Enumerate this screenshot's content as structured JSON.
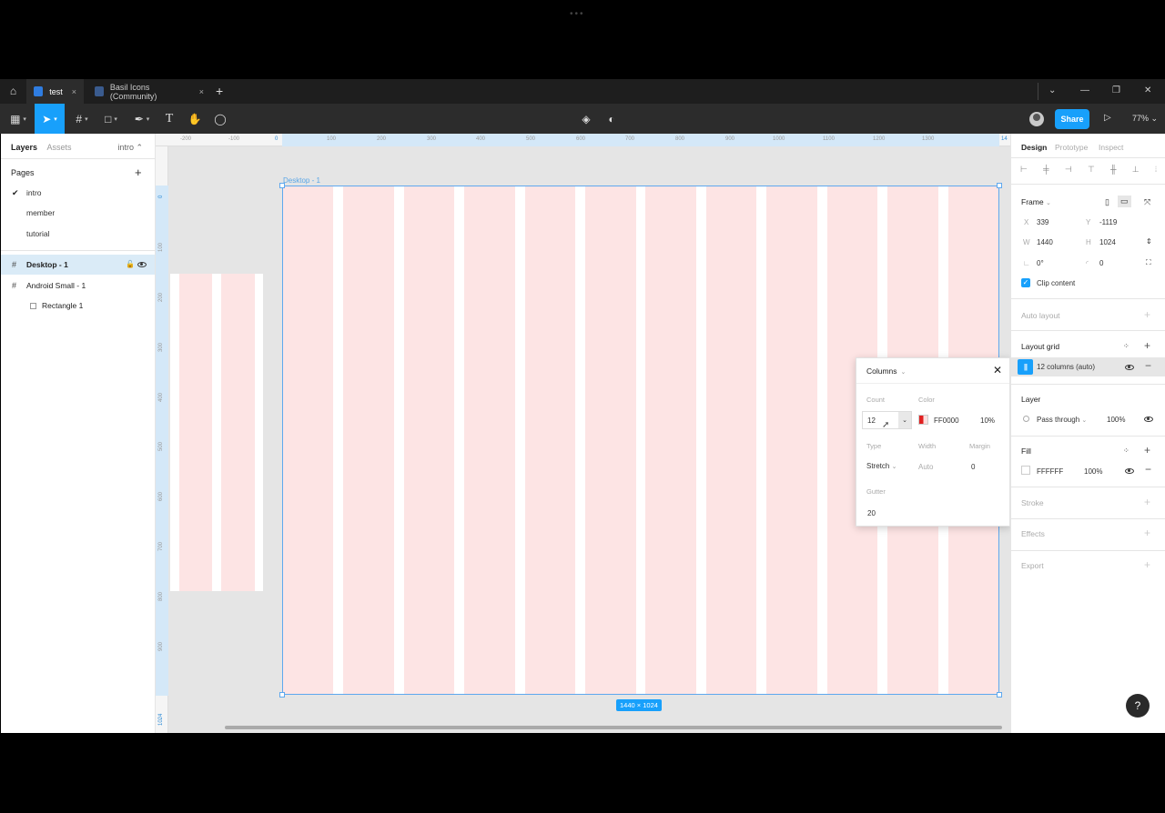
{
  "tabbar": {
    "tabs": [
      {
        "label": "test",
        "active": true
      },
      {
        "label": "Basil Icons (Community)",
        "active": false
      }
    ],
    "add_icon": "+",
    "close_icon": "×"
  },
  "toolbar": {
    "share_label": "Share",
    "zoom": "77%"
  },
  "left_panel": {
    "tab_layers": "Layers",
    "tab_assets": "Assets",
    "current_page": "intro",
    "pages_title": "Pages",
    "pages": [
      "intro",
      "member",
      "tutorial"
    ],
    "layers": [
      "Desktop - 1",
      "Android Small - 1",
      "Rectangle 1"
    ]
  },
  "canvas": {
    "frame_label": "Desktop - 1",
    "size_badge": "1440 × 1024",
    "ruler_top": [
      "-200",
      "-100",
      "0",
      "100",
      "200",
      "300",
      "400",
      "500",
      "600",
      "700",
      "800",
      "900",
      "1000",
      "1100",
      "1200",
      "1300",
      "14"
    ],
    "ruler_left": [
      "0",
      "100",
      "200",
      "300",
      "400",
      "500",
      "600",
      "700",
      "800",
      "900",
      "1024"
    ],
    "grid_color": "#fde4e4",
    "selection_color": "#5ea8ee"
  },
  "popup": {
    "title": "Columns",
    "count_label": "Count",
    "count_value": "12",
    "color_label": "Color",
    "color_hex": "FF0000",
    "color_opacity": "10%",
    "type_label": "Type",
    "type_value": "Stretch",
    "width_label": "Width",
    "width_value": "Auto",
    "margin_label": "Margin",
    "margin_value": "0",
    "gutter_label": "Gutter",
    "gutter_value": "20"
  },
  "right_panel": {
    "tabs": [
      "Design",
      "Prototype",
      "Inspect"
    ],
    "frame_title": "Frame",
    "x_label": "X",
    "x_value": "339",
    "y_label": "Y",
    "y_value": "-1119",
    "w_label": "W",
    "w_value": "1440",
    "h_label": "H",
    "h_value": "1024",
    "rotation_value": "0°",
    "radius_value": "0",
    "clip_content": "Clip content",
    "auto_layout": "Auto layout",
    "layout_grid": "Layout grid",
    "grid_item": "12 columns (auto)",
    "layer_title": "Layer",
    "blend_mode": "Pass through",
    "layer_opacity": "100%",
    "fill_title": "Fill",
    "fill_hex": "FFFFFF",
    "fill_opacity": "100%",
    "stroke": "Stroke",
    "effects": "Effects",
    "export": "Export"
  },
  "help_label": "?",
  "accent": "#18a0fb"
}
